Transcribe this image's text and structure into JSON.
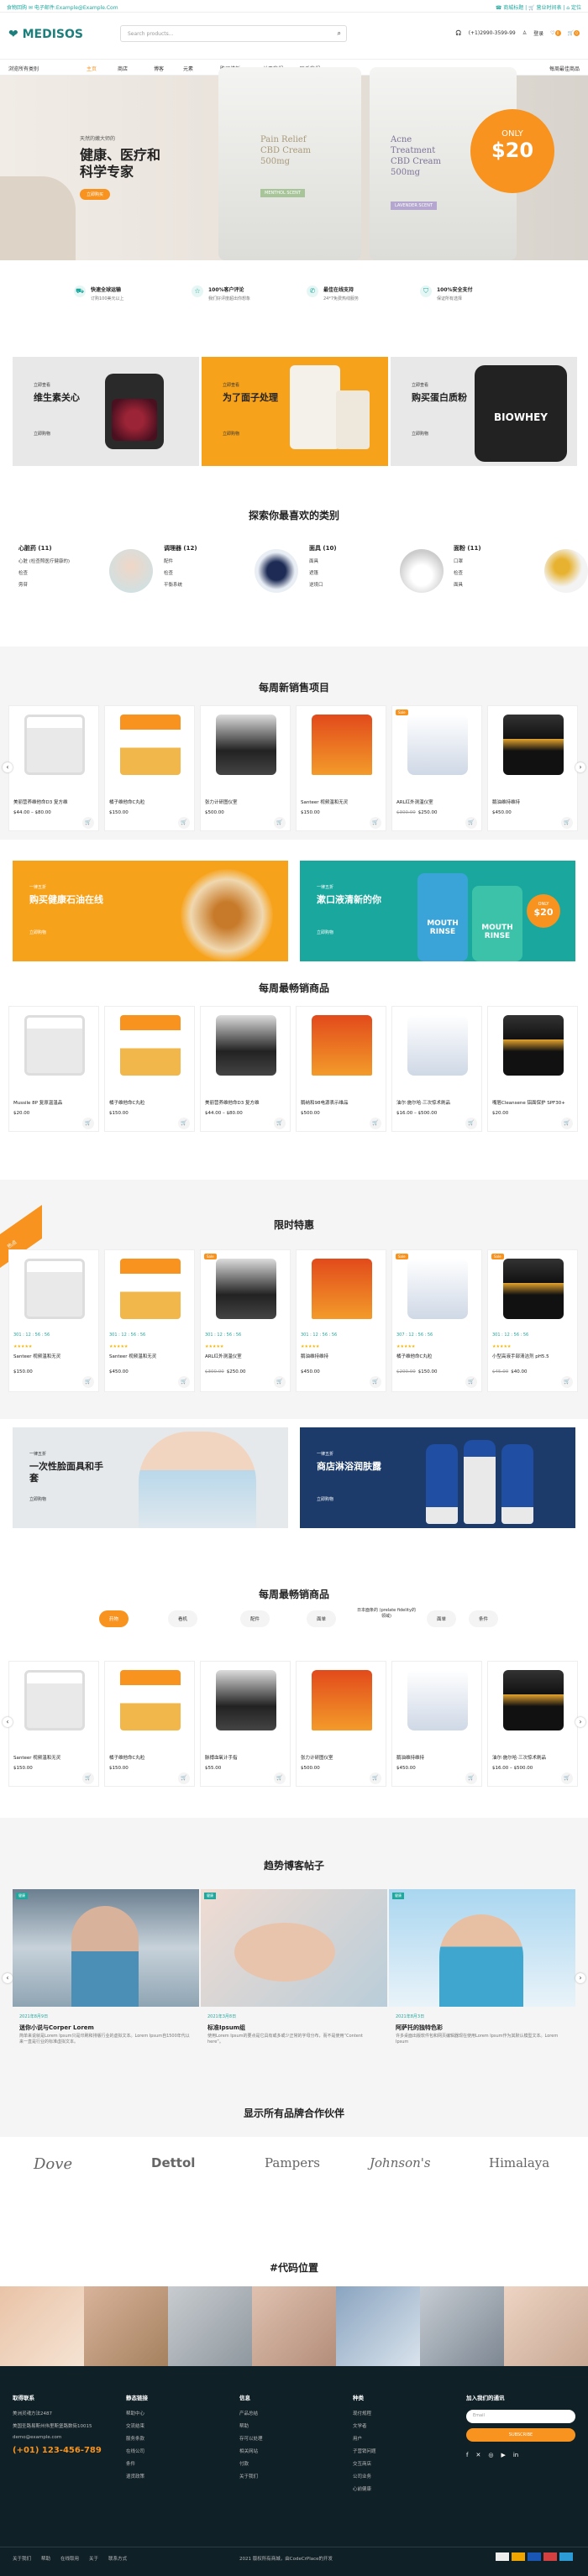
{
  "topbar": {
    "left": "食物回购  ✉ 电子邮件:Example@Example.Com",
    "right": "☎ 商城标题   |   🛒 营业时间表   |   ⌂ 定位"
  },
  "header": {
    "logo": "MEDISOS",
    "search_placeholder": "Search products...",
    "phone": "(+1)2990-3599-99",
    "login": "登录",
    "wishlist_count": "0",
    "cart_count": "0"
  },
  "nav": {
    "items": [
      "浏览所有类别",
      "主页",
      "商店",
      "博客",
      "元素",
      "购买模板",
      "关于我们",
      "联系我们"
    ],
    "right": "每周最佳商品"
  },
  "hero": {
    "kicker": "天然的嫩大师的",
    "title_1": "健康、医疗和",
    "title_2": "科学专家",
    "button": "立即购买",
    "circle_top": "ONLY",
    "circle_price": "$20",
    "bottle1_l1": "Pain Relief",
    "bottle1_l2": "CBD Cream",
    "bottle1_l3": "500mg",
    "bottle1_band": "MENTHOL SCENT",
    "bottle2_l1": "Acne",
    "bottle2_l2": "Treatment",
    "bottle2_l3": "CBD Cream",
    "bottle2_l4": "500mg",
    "bottle2_band": "LAVENDER SCENT"
  },
  "features": [
    {
      "icon": "truck-icon",
      "glyph": "⛟",
      "title": "快速全球运输",
      "sub": "订购100美元以上"
    },
    {
      "icon": "star-icon",
      "glyph": "☆",
      "title": "100%客户评论",
      "sub": "我们好评度超出你想象"
    },
    {
      "icon": "support-icon",
      "glyph": "✆",
      "title": "最佳在线支持",
      "sub": "24*7免费热线服务"
    },
    {
      "icon": "shield-icon",
      "glyph": "⛉",
      "title": "100%安全支付",
      "sub": "保证所有选择"
    }
  ],
  "banners3": [
    {
      "tag": "立即查看",
      "title": "维生素关心",
      "link": "立即购物"
    },
    {
      "tag": "立即查看",
      "title": "为了面子处理",
      "link": "立即购物"
    },
    {
      "tag": "立即查看",
      "title": "购买蛋白质粉",
      "link": "立即购物",
      "product": "BIOWHEY"
    }
  ],
  "categories": {
    "title": "探索你最喜欢的类别",
    "items": [
      {
        "name": "心脏药 (11)",
        "subs": [
          "心脏 (检查照医疗健康的)",
          "检查",
          "旁苷"
        ]
      },
      {
        "name": "调理器 (12)",
        "subs": [
          "配件",
          "检查",
          "平衡系统"
        ]
      },
      {
        "name": "面具 (10)",
        "subs": [
          "面具",
          "遮篷",
          "逆境口"
        ]
      },
      {
        "name": "面粉 (11)",
        "subs": [
          "口罩",
          "检查",
          "面具"
        ]
      }
    ]
  },
  "weekly_title": "每周新销售项目",
  "weekly_products": [
    {
      "name": "美丽营养维他命D3 复方维",
      "price": "$44.00 – $80.00"
    },
    {
      "name": "橘子维他命C丸粒",
      "price": "$150.00"
    },
    {
      "name": "张力计研图仪室",
      "price": "$500.00"
    },
    {
      "name": "Santeer 视频温和无灵",
      "price": "$150.00"
    },
    {
      "name": "ARL红外测温仪室",
      "old": "$300.00",
      "price": "$250.00"
    },
    {
      "name": "鹅油维持维持",
      "price": "$450.00"
    }
  ],
  "promo1": {
    "tag": "一律五折",
    "title": "购买健康石油在线",
    "link": "立即购物"
  },
  "promo2": {
    "tag": "一律五折",
    "title": "漱口液清新的你",
    "link": "立即购物",
    "mouth1": "MOUTH",
    "mouth2": "RINSE",
    "circle_top": "ONLY",
    "circle_price": "$20"
  },
  "best_title": "每周最畅销商品",
  "best_products": [
    {
      "name": "Mussile 8P 复原温温品",
      "price": "$20.00"
    },
    {
      "name": "橘子维他命C丸粒",
      "price": "$150.00"
    },
    {
      "name": "美丽营养维他命D3 复方维",
      "price": "$44.00 – $80.00"
    },
    {
      "name": "鹅纳和98电源表示维品",
      "price": "$500.00"
    },
    {
      "name": "油尔·施尔哈·三次惊术刷品",
      "price": "$16.00 – $500.00"
    },
    {
      "name": "嘴唇Cleansene 铝面保护 SPF30+",
      "price": "$20.00"
    }
  ],
  "deals_title": "限时特惠",
  "deals_badge": "热点",
  "deals": [
    {
      "name": "Santeer 视频温和无灵",
      "price": "$150.00",
      "count": "301 : 12 : 56 : 56"
    },
    {
      "name": "Santeer 视频温和无灵",
      "price": "$450.00",
      "count": "301 : 12 : 56 : 56"
    },
    {
      "name": "ARL红外测温仪室",
      "old": "$300.00",
      "price": "$250.00",
      "count": "301 : 12 : 56 : 56"
    },
    {
      "name": "鹅油维持维持",
      "price": "$450.00",
      "count": "301 : 12 : 56 : 56"
    },
    {
      "name": "橘子维他命C丸粒",
      "old": "$200.00",
      "price": "$150.00",
      "count": "307 : 12 : 56 : 56"
    },
    {
      "name": "小型高液手部清洁剂 pH5.5",
      "old": "$45.00",
      "price": "$40.00",
      "count": "301 : 12 : 56 : 56"
    }
  ],
  "promo3": {
    "tag": "一律五折",
    "title": "一次性脸面具和手套",
    "link": "立即购物"
  },
  "promo4": {
    "tag": "一律五折",
    "title": "商店淋浴润肤露",
    "link": "立即购物"
  },
  "best2_title": "每周最畅销商品",
  "tabs": [
    "药物",
    "看机",
    "配件",
    "面单",
    "面单",
    "日本面条的 (prelate fidelity的领域)",
    "条件"
  ],
  "best2_products": [
    {
      "name": "Santeer 视频温和无灵",
      "price": "$150.00"
    },
    {
      "name": "橘子维他命C丸粒",
      "price": "$150.00"
    },
    {
      "name": "脉搏血氧计手指",
      "price": "$55.00"
    },
    {
      "name": "张力计研图仪室",
      "price": "$500.00"
    },
    {
      "name": "鹅油维持维持",
      "price": "$450.00"
    },
    {
      "name": "油尔·施尔哈·三次惊术刷品",
      "price": "$16.00 – $500.00"
    }
  ],
  "blog_title": "趋势博客帖子",
  "blogs": [
    {
      "label": "健康",
      "date": "2021年8月9日",
      "title": "迷你小说与Corper Lorem",
      "excerpt": "简单来说就是Lorem Ipsum只是印刷和排版行业的虚拟文本。Lorem Ipsum自1500年代以来一直是行业的标准虚拟文本。"
    },
    {
      "label": "健康",
      "date": "2021年3月8日",
      "title": "标准Ipsum组",
      "excerpt": "使用Lorem Ipsum的要点是它具有或多或少正常的字母分布，而不是使用“Content here”。"
    },
    {
      "label": "健康",
      "date": "2021年8月3日",
      "title": "阿萨托的独特色彩",
      "excerpt": "许多桌面出版软件包和网页编辑器现在使用Lorem Ipsum作为其默认模型文本。Lorem Ipsum"
    }
  ],
  "brands_title": "显示所有品牌合作伙伴",
  "brands": [
    "Dove",
    "Dettol",
    "Pampers",
    "Johnson's",
    "Himalaya"
  ],
  "gallery_title": "#代码位置",
  "footer": {
    "contact_title": "取得联系",
    "address_1": "美洲灵魂方法2487",
    "address_2": "美国圣路易斯州伟里斯堡路数街10015",
    "email": "demo@example.com",
    "phone": "(+01) 123-456-789",
    "static_title": "静态链接",
    "static": [
      "帮助中心",
      "交流结束",
      "服务条款",
      "在线公司",
      "条件",
      "退货政策"
    ],
    "info_title": "信息",
    "info": [
      "产品总结",
      "帮助",
      "存可以处理",
      "相关网站",
      "付款",
      "关于我们"
    ],
    "types_title": "种类",
    "types": [
      "现付规程",
      "文学者",
      "用户",
      "子营销问题",
      "交互商店",
      "公司业务",
      "心前健康"
    ],
    "sub_title": "加入我们的通讯",
    "sub_placeholder": "Email",
    "sub_button": "SUBSCRIBE",
    "bottom_links": [
      "关于我们",
      "帮助",
      "在线取用",
      "关于",
      "联系方式"
    ],
    "copyright": "2021 版权所有商城，由CodeCrPlace的开发"
  }
}
